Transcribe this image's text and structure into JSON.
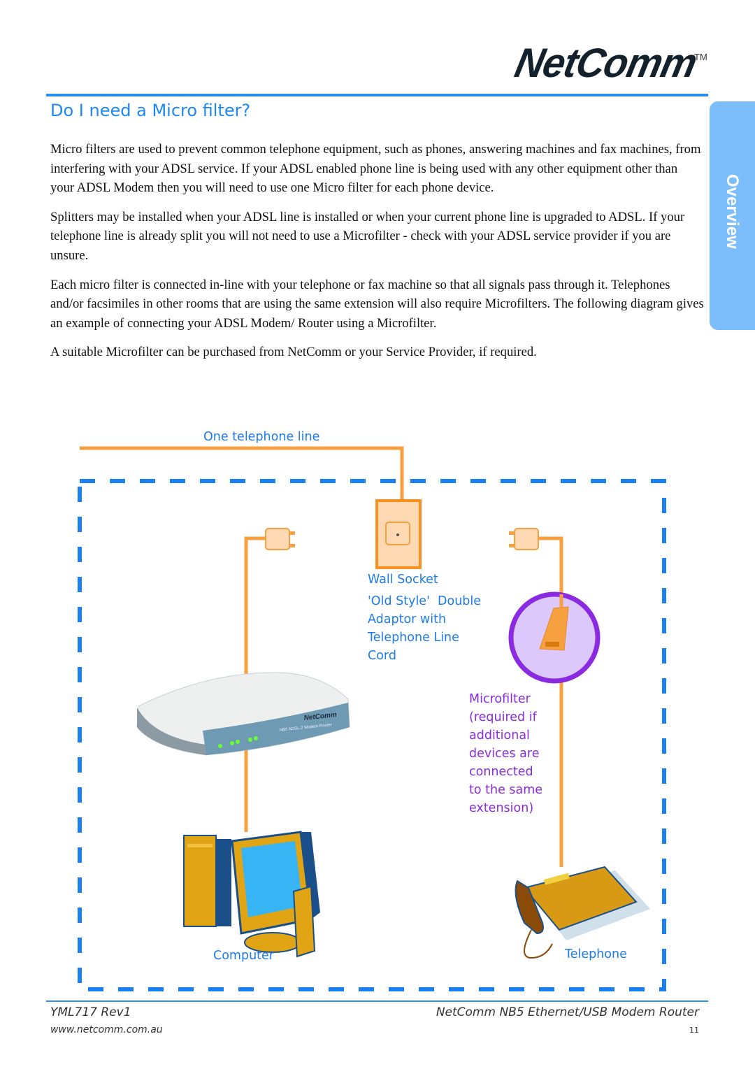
{
  "header": {
    "logo_text": "NetComm",
    "trademark": "TM",
    "side_tab_label": "Overview"
  },
  "page_title": "Do I need a Micro filter?",
  "paragraphs": [
    "Micro filters are used to prevent common telephone equipment, such as phones, answering machines and fax machines, from interfering with your ADSL service.  If your ADSL enabled phone line is being used with any other equipment other than your ADSL Modem then you will need to use one Micro filter for each phone device.",
    "Splitters may be installed when your ADSL line is installed or when your current phone line is upgraded to ADSL.  If your telephone line is already split you will not need to use a Microfilter - check with your ADSL service provider if you are unsure.",
    "Each micro filter is connected in-line with your telephone or fax machine so that all signals pass through it.   Telephones and/or facsimiles in other rooms that are using the same extension will also require Microfilters. The following diagram gives an example of connecting your ADSL Modem/ Router using a Microfilter.",
    "A suitable Microfilter can be purchased from NetComm or your Service Provider, if required."
  ],
  "diagram": {
    "labels": {
      "telephone_line": "One telephone line",
      "wall_socket": "Wall Socket",
      "adaptor": "'Old Style'  Double\nAdaptor with\nTelephone Line\nCord",
      "microfilter": "Microfilter\n(required if\nadditional\ndevices are\nconnected\nto the same\nextension)",
      "computer": "Computer",
      "telephone": "Telephone",
      "router_brand": "NetComm",
      "router_model": "NB5 ADSL-2 Modem Router"
    },
    "colors": {
      "cable": "#f7a040",
      "dashed_border": "#1a7ff0",
      "microfilter_ring": "#8a2be2",
      "microfilter_fill": "#dcc8fa"
    }
  },
  "footer": {
    "doc_id": "YML717 Rev1",
    "product": "NetComm NB5 Ethernet/USB Modem Router",
    "website": "www.netcomm.com.au",
    "page_number": "11"
  }
}
